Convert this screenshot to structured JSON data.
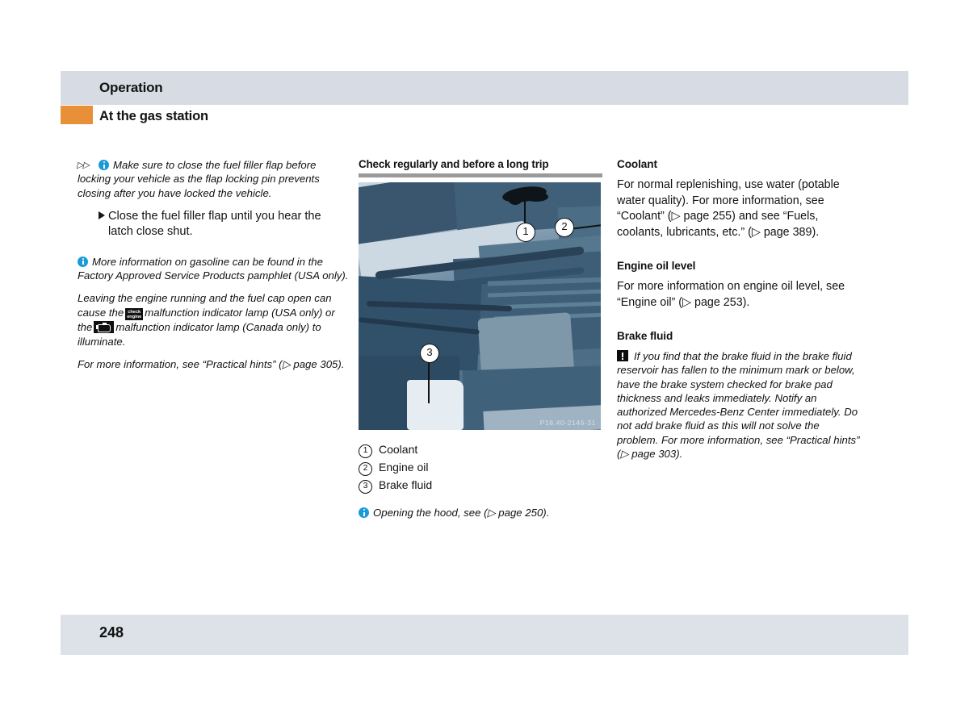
{
  "document": {
    "header_title": "Operation",
    "section_title": "At the gas station",
    "page_number": "248",
    "accent_color": "#e79038",
    "band_color": "#d7dce4",
    "footer_band_color": "#dde1e8",
    "info_icon_color": "#1a9ad8"
  },
  "left_column": {
    "continued_note": {
      "arrows": "▷▷",
      "icon": "info-icon",
      "text": "Make sure to close the fuel filler flap before locking your vehicle as the flap locking pin prevents closing after you have locked the vehicle."
    },
    "step": {
      "bullet": "arrow-bullet",
      "text": "Close the fuel filler flap until you hear the latch close shut."
    },
    "gasoline_note": {
      "icon": "info-icon",
      "text": "More information on gasoline can be found in the Factory Approved Service Products pamphlet (USA only)."
    },
    "mil_note": {
      "part1": "Leaving the engine running and the fuel cap open can cause the",
      "symbol1": "check engine",
      "symbol1_line1": "check",
      "symbol1_line2": "engine",
      "part2": "malfunction indicator lamp (USA only) or the",
      "symbol2": "engine-mil-icon",
      "part3": "malfunction indicator lamp (Canada only) to illuminate."
    },
    "more_info": {
      "text": "For more information, see “Practical hints” (▷ page 305)."
    }
  },
  "middle_column": {
    "heading": "Check regularly and before a long trip",
    "photo": {
      "alt": "engine-compartment-photo",
      "watermark": "P18.40-2146-31",
      "callouts": [
        {
          "number": "1",
          "label": "Coolant"
        },
        {
          "number": "2",
          "label": "Engine oil"
        },
        {
          "number": "3",
          "label": "Brake fluid"
        }
      ]
    },
    "legend": [
      {
        "number": "1",
        "label": "Coolant"
      },
      {
        "number": "2",
        "label": "Engine oil"
      },
      {
        "number": "3",
        "label": "Brake fluid"
      }
    ],
    "hood_note": {
      "icon": "info-icon",
      "text": "Opening the hood, see (▷ page 250)."
    }
  },
  "right_column": {
    "coolant": {
      "heading": "Coolant",
      "body": "For normal replenishing, use water (potable water quality). For more information, see “Coolant” (▷ page 255) and see “Fuels, coolants, lubricants, etc.” (▷ page 389)."
    },
    "engine_oil_level": {
      "heading": "Engine oil level",
      "body": "For more information on engine oil level, see “Engine oil” (▷ page 253)."
    },
    "brake_fluid": {
      "heading": "Brake fluid",
      "warning_icon": "warning-icon",
      "warning": "If you find that the brake fluid in the brake fluid reservoir has fallen to the minimum mark or below, have the brake system checked for brake pad thickness and leaks immediately. Notify an authorized Mercedes-Benz Center immediately. Do not add brake fluid as this will not solve the problem. For more information, see “Practical hints” (▷ page 303)."
    }
  }
}
